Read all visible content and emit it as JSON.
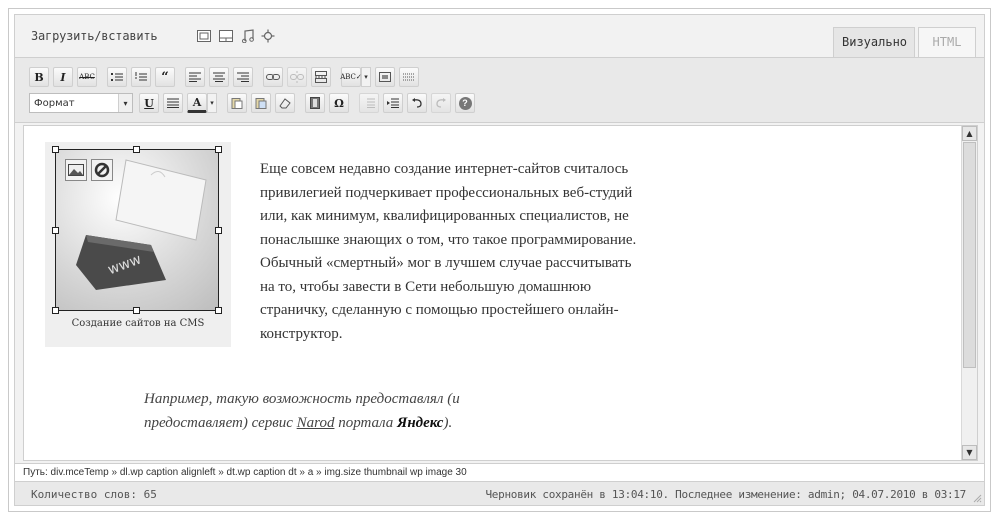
{
  "media": {
    "upload_label": "Загрузить/вставить",
    "icons": [
      "image-icon",
      "video-icon",
      "audio-icon",
      "media-icon"
    ]
  },
  "tabs": {
    "visual": "Визуально",
    "html": "HTML",
    "active": "visual"
  },
  "toolbar": {
    "row1": [
      "bold",
      "italic",
      "strikethrough",
      "bullet-list",
      "numbered-list",
      "blockquote",
      "align-left",
      "align-center",
      "align-right",
      "link",
      "unlink",
      "more",
      "spellcheck",
      "fullscreen",
      "kitchen-sink"
    ],
    "bold_label": "B",
    "italic_label": "I",
    "strike_label": "ABC",
    "format_select": "Формат",
    "underline_label": "U",
    "text_color_label": "A",
    "help_label": "?",
    "special_char_label": "Ω"
  },
  "content": {
    "image_caption": "Создание сайтов на CMS",
    "paragraph1_lines": [
      "Еще совсем недавно создание интернет-сайтов считалось",
      "привилегией подчеркивает профессиональных веб-студий",
      "или, как минимум, квалифицированных специалистов, не",
      "понаслышке знающих о том, что такое программирование.",
      "Обычный «смертный» мог в лучшем случае рассчитывать",
      "на то, чтобы завести в Сети небольшую домашнюю",
      "страничку, сделанную с помощью простейшего онлайн-",
      "конструктор."
    ],
    "paragraph2_line1": "Например, такую возможность предоставлял (и",
    "paragraph2_line2_before": "предоставляет) сервис ",
    "paragraph2_link": "Narod",
    "paragraph2_mid": " портала ",
    "paragraph2_bold": "Яндекс",
    "paragraph2_end": ")."
  },
  "path_bar": "Путь: div.mceTemp » dl.wp caption alignleft » dt.wp caption dt » a » img.size thumbnail wp image 30",
  "status": {
    "word_count": "Количество слов: 65",
    "draft": "Черновик сохранён в 13:04:10. Последнее изменение: admin; 04.07.2010 в 03:17"
  }
}
